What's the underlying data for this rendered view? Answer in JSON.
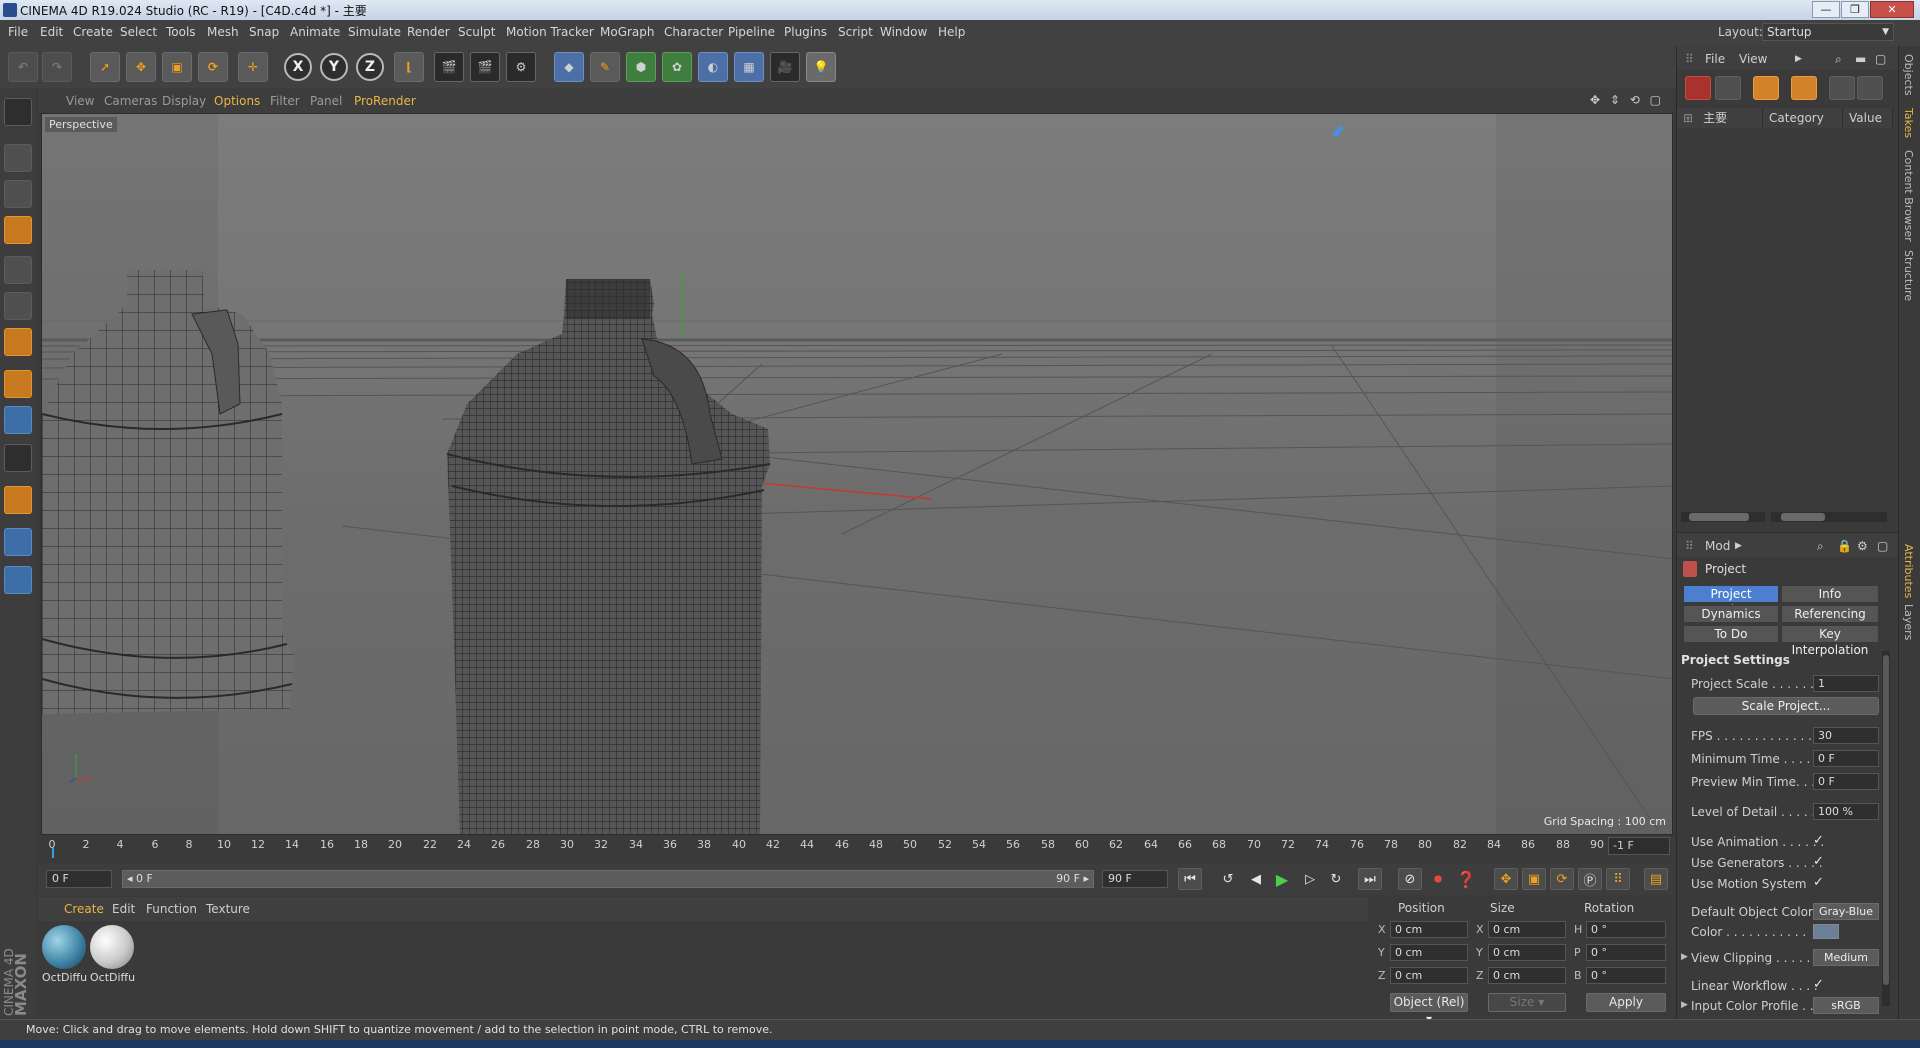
{
  "window": {
    "title": "CINEMA 4D R19.024 Studio (RC - R19) - [C4D.c4d *] - 主要",
    "buttons": [
      "—",
      "❐",
      "✕"
    ]
  },
  "menubar": {
    "items": [
      "File",
      "Edit",
      "Create",
      "Select",
      "Tools",
      "Mesh",
      "Snap",
      "Animate",
      "Simulate",
      "Render",
      "Sculpt",
      "Motion Tracker",
      "MoGraph",
      "Character",
      "Pipeline",
      "Plugins",
      "Script",
      "Window",
      "Help"
    ],
    "layout_label": "Layout:",
    "layout_value": "Startup"
  },
  "toolbar": {
    "axis_x": "X",
    "axis_y": "Y",
    "axis_z": "Z"
  },
  "viewport": {
    "menu": [
      "View",
      "Cameras",
      "Display",
      "Options",
      "Filter",
      "Panel",
      "ProRender"
    ],
    "nav_icons": "✥ ⇕ ⟲ ▢",
    "label": "Perspective",
    "grid_spacing": "Grid Spacing : 100 cm"
  },
  "timeline": {
    "ticks": [
      "0",
      "2",
      "4",
      "6",
      "8",
      "10",
      "12",
      "14",
      "16",
      "18",
      "20",
      "22",
      "24",
      "26",
      "28",
      "30",
      "32",
      "34",
      "36",
      "38",
      "40",
      "42",
      "44",
      "46",
      "48",
      "50",
      "52",
      "54",
      "56",
      "58",
      "60",
      "62",
      "64",
      "66",
      "68",
      "70",
      "72",
      "74",
      "76",
      "78",
      "80",
      "82",
      "84",
      "86",
      "88",
      "90"
    ],
    "current_frame": "-1 F"
  },
  "transport": {
    "start_field": "0 F",
    "range_start": "◂ 0 F",
    "range_end": "90 F ▸",
    "end_field": "90 F"
  },
  "materials": {
    "menu": [
      "Create",
      "Edit",
      "Function",
      "Texture"
    ],
    "items": [
      {
        "name": "OctDiffu"
      },
      {
        "name": "OctDiffu"
      }
    ]
  },
  "coordinates": {
    "headers": [
      "Position",
      "Size",
      "Rotation"
    ],
    "rows": [
      {
        "pos_axis": "X",
        "pos": "0 cm",
        "size_axis": "X",
        "size": "0 cm",
        "rot_axis": "H",
        "rot": "0 °"
      },
      {
        "pos_axis": "Y",
        "pos": "0 cm",
        "size_axis": "Y",
        "size": "0 cm",
        "rot_axis": "P",
        "rot": "0 °"
      },
      {
        "pos_axis": "Z",
        "pos": "0 cm",
        "size_axis": "Z",
        "size": "0 cm",
        "rot_axis": "B",
        "rot": "0 °"
      }
    ],
    "mode_select": "Object (Rel) ▾",
    "size_select": "Size ▾",
    "apply": "Apply"
  },
  "status": {
    "text": "Move: Click and drag to move elements. Hold down SHIFT to quantize movement / add to the selection in point mode, CTRL to remove."
  },
  "branding": {
    "maxon": "MAXON",
    "cinema": "CINEMA 4D"
  },
  "object_manager": {
    "menu": [
      "File",
      "View"
    ],
    "take_name": "主要",
    "columns": [
      "Category",
      "Value"
    ]
  },
  "attributes": {
    "mode_label": "Mod",
    "object_name": "Project",
    "tabs": [
      "Project Settings",
      "Info",
      "Dynamics",
      "Referencing",
      "To Do",
      "Key Interpolation"
    ],
    "section_title": "Project Settings",
    "project_scale_label": "Project Scale . . . . . . .",
    "project_scale": "1",
    "scale_project_button": "Scale Project...",
    "fps_label": "FPS . . . . . . . . . . . . . . .",
    "fps": "30",
    "min_time_label": "Minimum Time . . . . . .",
    "min_time": "0 F",
    "preview_min_label": "Preview Min Time. . . .",
    "preview_min": "0 F",
    "lod_label": "Level of Detail . . . . . .",
    "lod": "100 %",
    "use_animation_label": "Use Animation . . . . . .",
    "use_generators_label": "Use Generators . . . . .",
    "use_motion_label": "Use Motion System",
    "checkmark": "✓",
    "default_color_label": "Default Object Color",
    "default_color": "Gray-Blue",
    "color_label": "Color . . . . . . . . . . .",
    "view_clipping_label": "View Clipping . . . . . .",
    "view_clipping": "Medium",
    "linear_workflow_label": "Linear Workflow . . . .",
    "input_profile_label": "Input Color Profile . .",
    "input_profile": "sRGB"
  },
  "side_tabs": [
    "Objects",
    "Takes",
    "Content Browser",
    "Structure",
    "Attributes",
    "Layers"
  ]
}
